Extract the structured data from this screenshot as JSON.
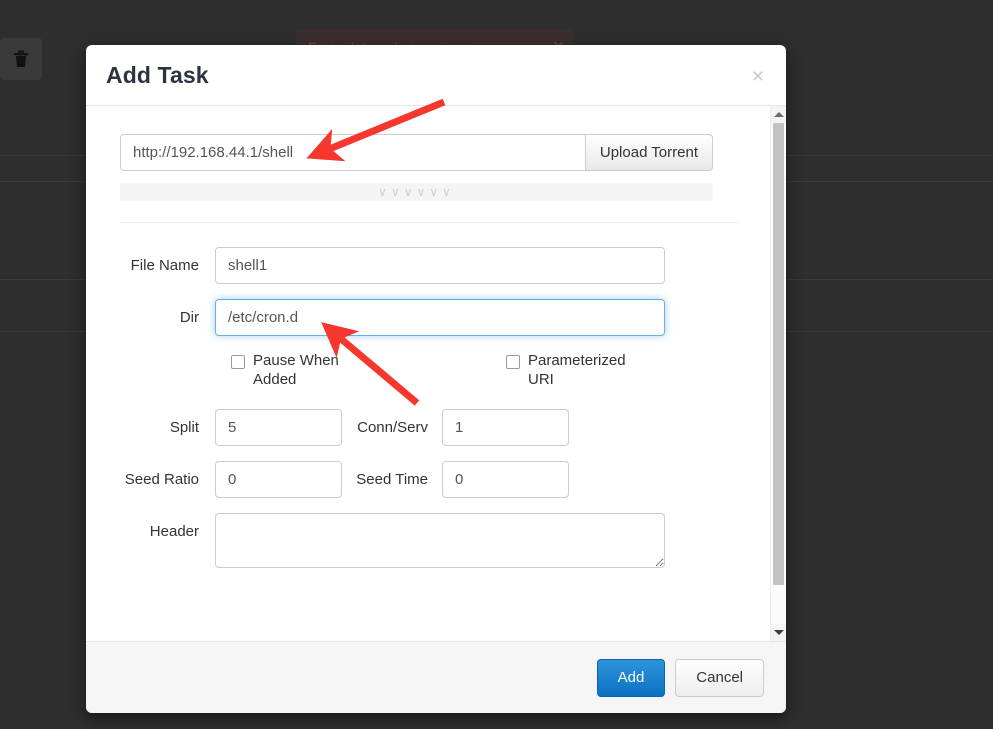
{
  "background": {
    "toolbar": {
      "delete_icon": "trash-icon"
    },
    "alert": {
      "prefix": "Error:",
      "message": " Internal server error",
      "close_label": "×"
    }
  },
  "modal": {
    "title": "Add Task",
    "close_label": "×",
    "uri": {
      "value": "http://192.168.44.1/shell",
      "placeholder": "",
      "upload_button": "Upload Torrent"
    },
    "collapse_bar": "∨∨∨∨∨∨",
    "fields": {
      "file_name": {
        "label": "File Name",
        "value": "shell1"
      },
      "dir": {
        "label": "Dir",
        "value": "/etc/cron.d",
        "focused": true
      },
      "pause_when_added": {
        "label": "Pause When Added",
        "checked": false
      },
      "parameterized_uri": {
        "label": "Parameterized URI",
        "checked": false
      },
      "split": {
        "label": "Split",
        "value": "5"
      },
      "conn_serv": {
        "label": "Conn/Serv",
        "value": "1"
      },
      "seed_ratio": {
        "label": "Seed Ratio",
        "value": "0"
      },
      "seed_time": {
        "label": "Seed Time",
        "value": "0"
      },
      "header": {
        "label": "Header",
        "value": ""
      }
    },
    "footer": {
      "add_label": "Add",
      "cancel_label": "Cancel"
    }
  },
  "colors": {
    "primary": "#0b72c4",
    "focus_ring": "#66afe9",
    "annotation_arrow": "#f5372e",
    "backdrop": "#2e2e2e"
  }
}
